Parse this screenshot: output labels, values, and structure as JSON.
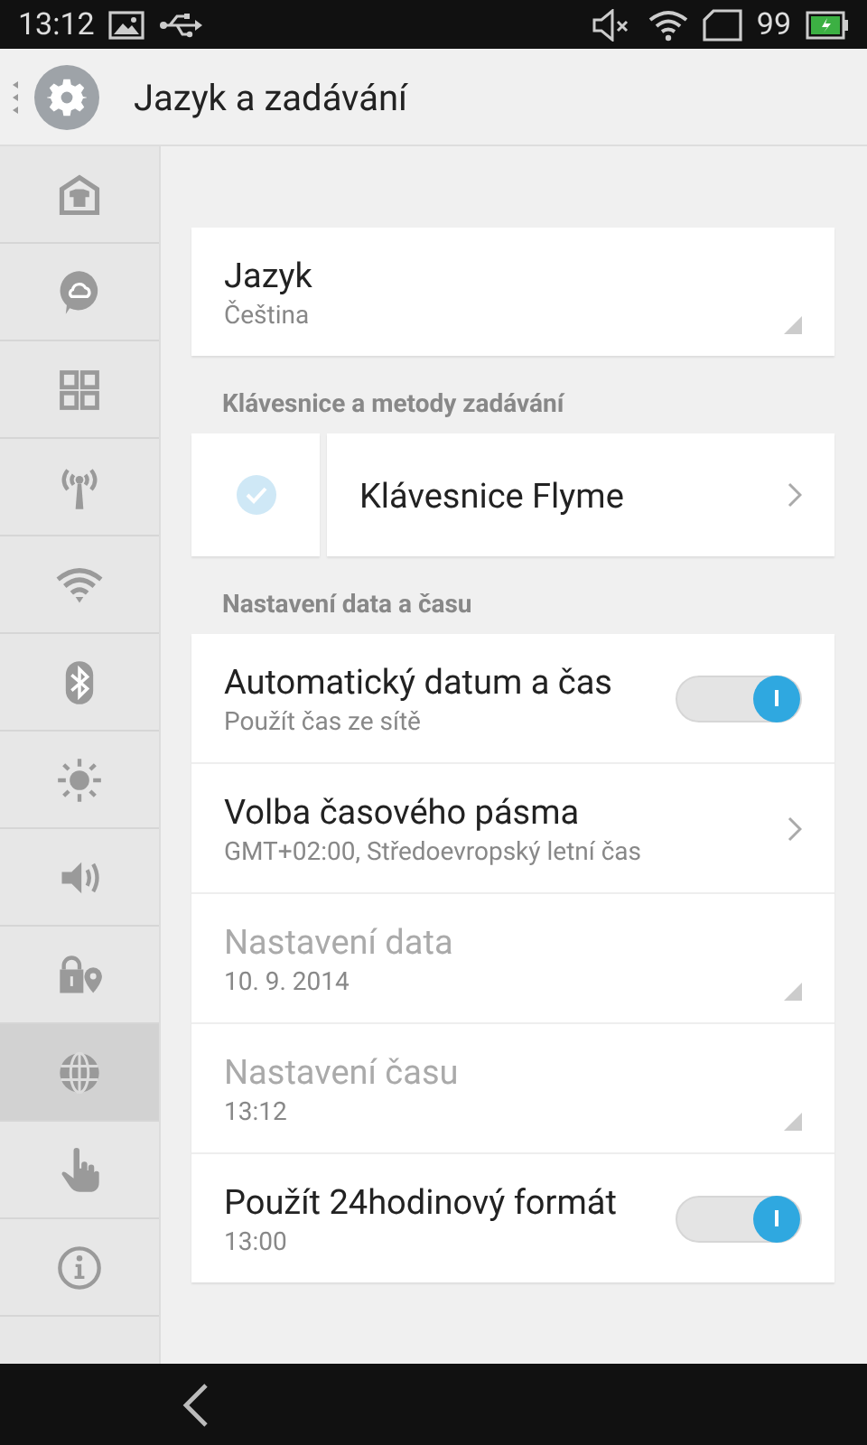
{
  "status_bar": {
    "time": "13:12",
    "battery": "99"
  },
  "header": {
    "title": "Jazyk a zadávání"
  },
  "sidebar": {
    "items": [
      {
        "kind": "store",
        "selected": false
      },
      {
        "kind": "cloud",
        "selected": false
      },
      {
        "kind": "apps",
        "selected": false
      },
      {
        "kind": "antenna",
        "selected": false
      },
      {
        "kind": "wifi",
        "selected": false
      },
      {
        "kind": "bluetooth",
        "selected": false
      },
      {
        "kind": "brightness",
        "selected": false
      },
      {
        "kind": "sound",
        "selected": false
      },
      {
        "kind": "lock-location",
        "selected": false
      },
      {
        "kind": "globe",
        "selected": true
      },
      {
        "kind": "hand",
        "selected": false
      },
      {
        "kind": "info",
        "selected": false
      }
    ]
  },
  "sections": [
    {
      "items": [
        {
          "kind": "dropdown",
          "title": "Jazyk",
          "subtitle": "Čeština",
          "disabled": false
        }
      ]
    },
    {
      "header": "Klávesnice a metody zadávání",
      "items": [
        {
          "kind": "checkbox",
          "title": "Klávesnice Flyme",
          "checked": true
        }
      ]
    },
    {
      "header": "Nastavení data a času",
      "items": [
        {
          "kind": "toggle",
          "title": "Automatický datum a čas",
          "subtitle": "Použít čas ze sítě",
          "on": true,
          "disabled": false
        },
        {
          "kind": "chevron",
          "title": "Volba časového pásma",
          "subtitle": "GMT+02:00, Středoevropský letní čas",
          "disabled": false
        },
        {
          "kind": "dropdown",
          "title": "Nastavení data",
          "subtitle": "10. 9. 2014",
          "disabled": true
        },
        {
          "kind": "dropdown",
          "title": "Nastavení času",
          "subtitle": "13:12",
          "disabled": true
        },
        {
          "kind": "toggle",
          "title": "Použít 24hodinový formát",
          "subtitle": "13:00",
          "on": true,
          "disabled": false
        }
      ]
    }
  ]
}
